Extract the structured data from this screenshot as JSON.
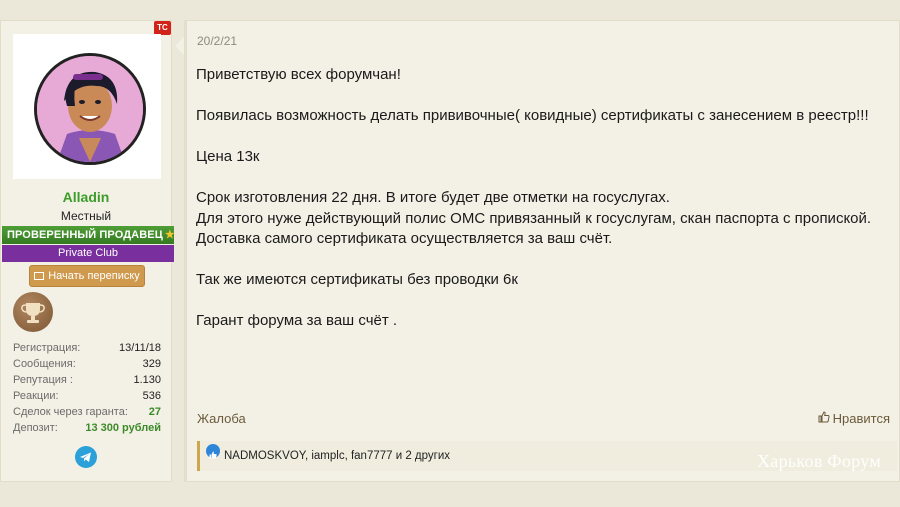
{
  "user": {
    "badge": "TC",
    "name": "Alladin",
    "title": "Местный",
    "verified": "ПРОВЕРЕННЫЙ ПРОДАВЕЦ",
    "club": "Private Club",
    "message_button": "Начать переписку",
    "stats": [
      {
        "label": "Регистрация:",
        "value": "13/11/18"
      },
      {
        "label": "Сообщения:",
        "value": "329"
      },
      {
        "label": "Репутация :",
        "value": "1.130"
      },
      {
        "label": "Реакции:",
        "value": "536"
      },
      {
        "label": "Сделок через гаранта:",
        "value": "27"
      },
      {
        "label": "Депозит:",
        "value": "13 300 рублей"
      }
    ]
  },
  "post": {
    "date": "20/2/21",
    "lines": [
      "Приветствую всех форумчан!",
      "",
      "Появилась возможность делать прививочные( ковидные) сертификаты с занесением в реестр!!!",
      "",
      "Цена 13к",
      "",
      "Срок изготовления 22 дня. В итоге будет две отметки на госуслугах.",
      "Для этого нуже действующий полис ОМС привязанный к госуслугам, скан паспорта с пропиской.",
      "Доставка самого сертификата осуществляется за ваш счёт.",
      "",
      "Так же имеются сертификаты без проводки 6к",
      "",
      "Гарант форума за ваш счёт ."
    ],
    "report_label": "Жалоба",
    "like_label": "Нравится",
    "reactions_text": "NADMOSKVOY, iamplc, fan7777 и 2 других"
  },
  "watermark": "Харьков Форум"
}
